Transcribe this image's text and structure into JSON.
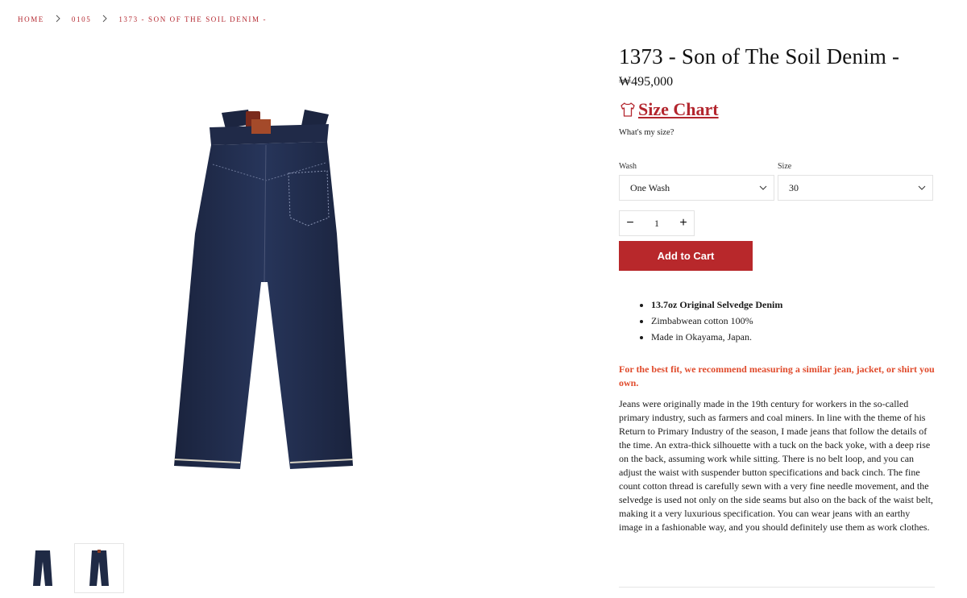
{
  "breadcrumb": [
    "HOME",
    "0105",
    "1373 - SON OF THE SOIL DENIM -"
  ],
  "product": {
    "title": "1373 - Son of The Soil Denim -",
    "price": "₩495,000",
    "size_chart_label": "Size Chart",
    "size_help": "What's my size?"
  },
  "options": {
    "wash": {
      "label": "Wash",
      "value": "One Wash"
    },
    "size": {
      "label": "Size",
      "value": "30"
    }
  },
  "quantity": {
    "minus": "−",
    "value": "1",
    "plus": "+"
  },
  "add_to_cart": "Add to Cart",
  "features": [
    "13.7oz Original Selvedge Denim",
    "Zimbabwean cotton 100%",
    "Made in Okayama, Japan."
  ],
  "fit_note": "For the best fit, we recommend measuring a similar jean, jacket, or shirt you own.",
  "description": "Jeans were originally made in the 19th century for workers in the so-called primary industry, such as farmers and coal miners. In line with the theme of his Return to Primary Industry of the season, I made jeans that follow the details of the time. An extra-thick silhouette with a tuck on the back yoke, with a deep rise on the back, assuming work while sitting. There is no belt loop, and you can adjust the waist with suspender button specifications and back cinch. The fine count cotton thread is carefully sewn with a very fine needle movement, and the selvedge is used not only on the side seams but also on the back of the waist belt, making it a very luxurious specification. You can wear jeans with an earthy image in a fashionable way, and you should definitely use them as work clothes.",
  "colors": {
    "accent": "#b8282b",
    "link": "#b3262e",
    "note": "#e04b2c",
    "denim": "#1f2a45"
  },
  "icons": {
    "breadcrumb_separator": "chevron-right-icon",
    "size_chart": "shirt-icon",
    "select": "chevron-down-icon"
  }
}
